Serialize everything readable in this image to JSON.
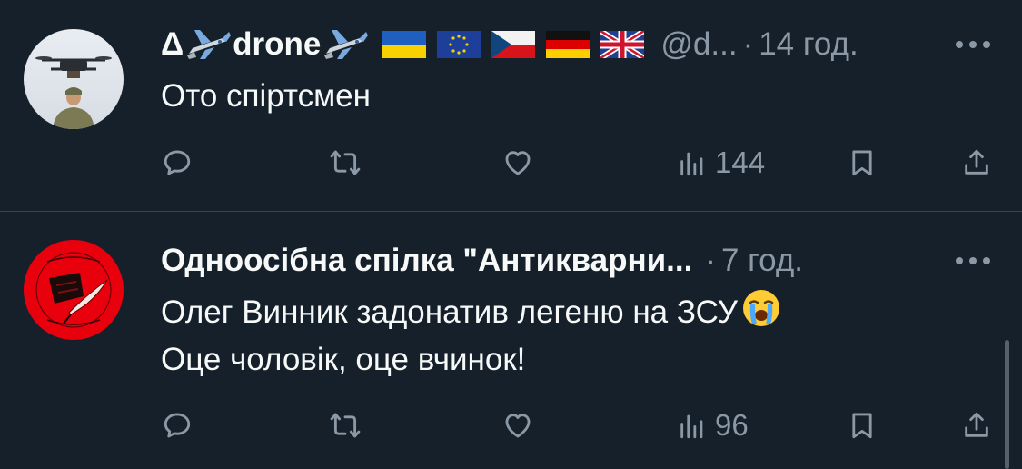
{
  "tweets": [
    {
      "display_name_prefix": "Δ",
      "display_name_main": "drone",
      "handle": "@d...",
      "separator": "·",
      "time": "14 год.",
      "text_lines": [
        "Ото спіртсмен"
      ],
      "flags": [
        "flag-ukraine-icon",
        "flag-eu-icon",
        "flag-czech-icon",
        "flag-germany-icon",
        "flag-uk-icon"
      ],
      "stats": {
        "views": "144"
      }
    },
    {
      "display_name": "Одноосібна спілка \"Антикварни...",
      "separator": "·",
      "time": "7 год.",
      "text_lines": [
        "Олег Винник задонатив легеню на ЗСУ",
        "Оце чоловік, оце вчинок!"
      ],
      "stats": {
        "views": "96"
      }
    }
  ],
  "colors": {
    "background": "#15202b",
    "text_primary": "#f7f9f9",
    "text_secondary": "#8b98a5",
    "divider": "#38444d"
  }
}
